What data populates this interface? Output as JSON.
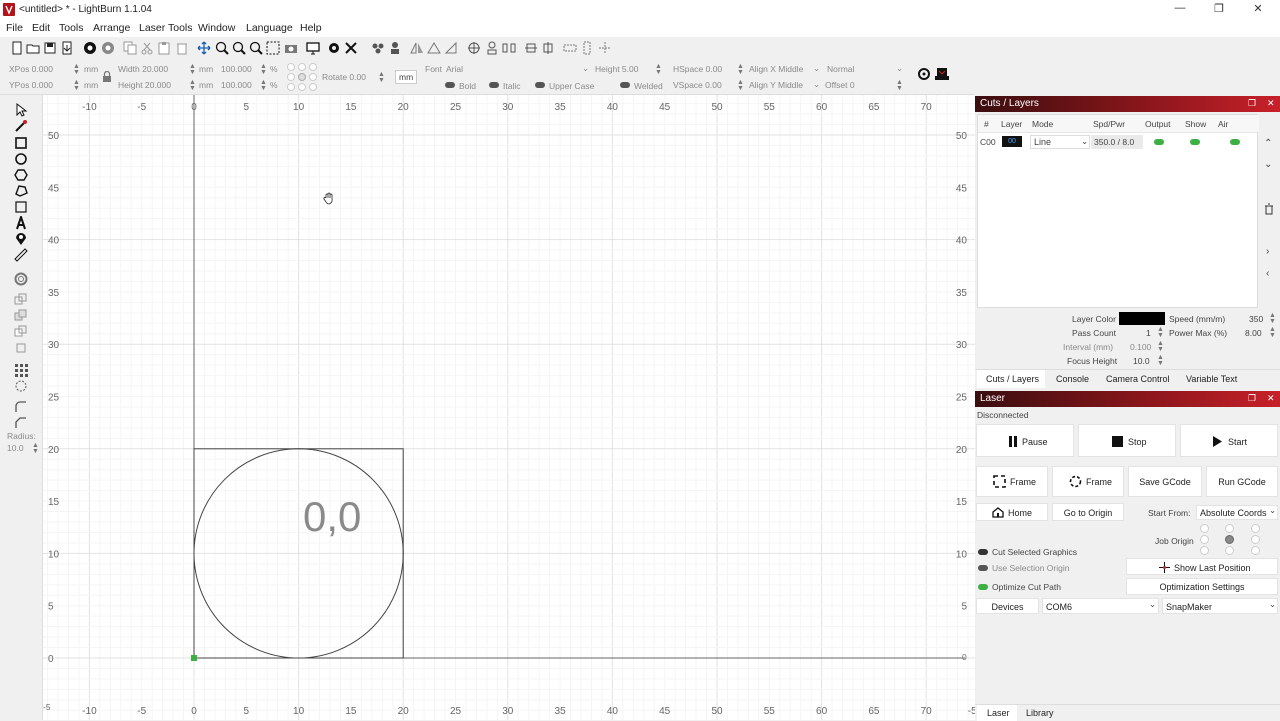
{
  "window": {
    "title": "<untitled> * - LightBurn 1.1.04",
    "minimize_glyph": "—",
    "maximize_glyph": "❐",
    "close_glyph": "✕"
  },
  "menu": [
    "File",
    "Edit",
    "Tools",
    "Arrange",
    "Laser Tools",
    "Window",
    "Language",
    "Help"
  ],
  "toolbar2": {
    "xpos": "XPos 0.000",
    "ypos": "YPos 0.000",
    "unit_mm1": "mm",
    "unit_mm2": "mm",
    "width": "Width 20.000",
    "height": "Height 20.000",
    "unit_mm3": "mm",
    "unit_mm4": "mm",
    "scale_w": "100.000",
    "scale_h": "100.000",
    "pct1": "%",
    "pct2": "%",
    "rotate": "Rotate 0.00",
    "rot_unit": "mm",
    "font_label": "Font",
    "font_value": "Arial",
    "height_label": "Height 5.00",
    "hspace": "HSpace 0.00",
    "vspace": "VSpace 0.00",
    "align_x": "Align X Middle",
    "align_y": "Align Y Middle",
    "normal": "Normal",
    "offset": "Offset 0",
    "bold": "Bold",
    "italic": "Italic",
    "upper_case": "Upper Case",
    "welded": "Welded"
  },
  "canvas": {
    "x_ticks": [
      "-10",
      "-5",
      "0",
      "5",
      "10",
      "15",
      "20",
      "25",
      "30",
      "35",
      "40",
      "45",
      "50",
      "55",
      "60",
      "65",
      "70"
    ],
    "bottom_x_ticks": [
      "-10",
      "-5",
      "0",
      "5",
      "10",
      "15",
      "20",
      "25",
      "30",
      "35",
      "40",
      "45",
      "50",
      "55",
      "60",
      "65",
      "70",
      "-5"
    ],
    "y_ticks": [
      "50",
      "45",
      "40",
      "35",
      "30",
      "25",
      "20",
      "15",
      "10",
      "5",
      "0"
    ],
    "bottom_left_tick": "-5",
    "right_axis_zero": "0",
    "shape_text": "0,0"
  },
  "left_tools": {
    "radius_label": "Radius:",
    "radius_value": "10.0"
  },
  "cuts_layers": {
    "title": "Cuts / Layers",
    "columns": [
      "#",
      "Layer",
      "Mode",
      "Spd/Pwr",
      "Output",
      "Show",
      "Air"
    ],
    "row": {
      "num": "C00",
      "layer": "00",
      "mode": "Line",
      "spd_pwr": "350.0 / 8.0"
    },
    "layer_color_label": "Layer Color",
    "layer_color": "#000000",
    "speed_label": "Speed (mm/m)",
    "speed_value": "350",
    "pass_count_label": "Pass Count",
    "pass_count_value": "1",
    "power_max_label": "Power Max (%)",
    "power_max_value": "8.00",
    "interval_label": "Interval (mm)",
    "interval_value": "0.100",
    "focus_height_label": "Focus Height",
    "focus_height_value": "10.0"
  },
  "tabs1": [
    "Cuts / Layers",
    "Console",
    "Camera Control",
    "Variable Text"
  ],
  "laser": {
    "title": "Laser",
    "status": "Disconnected",
    "pause": "Pause",
    "stop": "Stop",
    "start": "Start",
    "frame1": "Frame",
    "frame2": "Frame",
    "save_gcode": "Save GCode",
    "run_gcode": "Run GCode",
    "home": "Home",
    "go_to_origin": "Go to Origin",
    "start_from_label": "Start From:",
    "start_from_value": "Absolute Coords",
    "job_origin_label": "Job Origin",
    "cut_selected": "Cut Selected Graphics",
    "use_selection_origin": "Use Selection Origin",
    "optimize_cut_path": "Optimize Cut Path",
    "show_last_position": "Show Last Position",
    "optimization_settings": "Optimization Settings",
    "devices": "Devices",
    "port": "COM6",
    "machine": "SnapMaker"
  },
  "tabs2": [
    "Laser",
    "Library"
  ],
  "colors": {
    "accent_red": "#c8202a",
    "toggle_green": "#3cb043",
    "grid": "#eeeeee",
    "grid_major": "#e2e2e2"
  }
}
